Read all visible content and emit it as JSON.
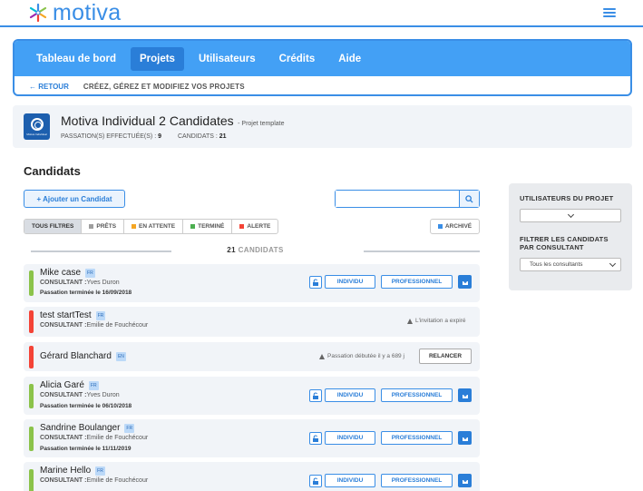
{
  "app": {
    "logo_text": "motiva"
  },
  "nav": {
    "tabs": [
      {
        "label": "Tableau de bord"
      },
      {
        "label": "Projets"
      },
      {
        "label": "Utilisateurs"
      },
      {
        "label": "Crédits"
      },
      {
        "label": "Aide"
      }
    ],
    "back_label": "← RETOUR",
    "subtitle": "CRÉEZ, GÉREZ ET MODIFIEZ VOS PROJETS"
  },
  "project": {
    "icon_caption": "Motiva Individual",
    "title": "Motiva Individual 2 Candidates",
    "type": "- Projet template",
    "passations_label": "PASSATION(S) EFFECTUÉE(S) :",
    "passations_value": "9",
    "candidats_label": "CANDIDATS :",
    "candidats_value": "21"
  },
  "candidates": {
    "title": "Candidats",
    "add_label": "+ Ajouter un Candidat",
    "search_placeholder": "",
    "filters": [
      {
        "label": "TOUS FILTRES",
        "color": ""
      },
      {
        "label": "PRÊTS",
        "color": "#9e9e9e"
      },
      {
        "label": "EN ATTENTE",
        "color": "#f5a623"
      },
      {
        "label": "TERMINÉ",
        "color": "#4caf50"
      },
      {
        "label": "ALERTE",
        "color": "#f44336"
      }
    ],
    "archive_label": "ARCHIVÉ",
    "archive_color": "#3a8ee6",
    "count_value": "21",
    "count_label": "CANDIDATS",
    "rows": [
      {
        "name": "Mike case",
        "lang": "FR",
        "status_color": "#8bc34a",
        "consultant_label": "CONSULTANT :",
        "consultant": "Yves Duron",
        "passation": "Passation terminée le 16/09/2018",
        "btn_individu": "INDIVIDU",
        "btn_pro": "PROFESSIONNEL"
      },
      {
        "name": "test startTest",
        "lang": "FR",
        "status_color": "#f44336",
        "consultant_label": "CONSULTANT :",
        "consultant": "Emilie de Fouchécour",
        "warning": "L'invitation a expiré"
      },
      {
        "name": "Gérard Blanchard",
        "lang": "EN",
        "status_color": "#f44336",
        "warning": "Passation débutée il y a 689 j",
        "btn_relancer": "RELANCER"
      },
      {
        "name": "Alicia Garé",
        "lang": "FR",
        "status_color": "#8bc34a",
        "consultant_label": "CONSULTANT :",
        "consultant": "Yves Duron",
        "passation": "Passation terminée le 06/10/2018",
        "btn_individu": "INDIVIDU",
        "btn_pro": "PROFESSIONNEL"
      },
      {
        "name": "Sandrine Boulanger",
        "lang": "FR",
        "status_color": "#8bc34a",
        "consultant_label": "CONSULTANT :",
        "consultant": "Emilie de Fouchécour",
        "passation": "Passation terminée le 11/11/2019",
        "btn_individu": "INDIVIDU",
        "btn_pro": "PROFESSIONNEL"
      },
      {
        "name": "Marine Hello",
        "lang": "FR",
        "status_color": "#8bc34a",
        "consultant_label": "CONSULTANT :",
        "consultant": "Emilie de Fouchécour",
        "btn_individu": "INDIVIDU",
        "btn_pro": "PROFESSIONNEL"
      }
    ]
  },
  "sidebar": {
    "users_label": "UTILISATEURS DU PROJET",
    "users_value": "",
    "filter_label": "FILTRER LES CANDIDATS PAR CONSULTANT",
    "filter_value": "Tous les consultants"
  }
}
